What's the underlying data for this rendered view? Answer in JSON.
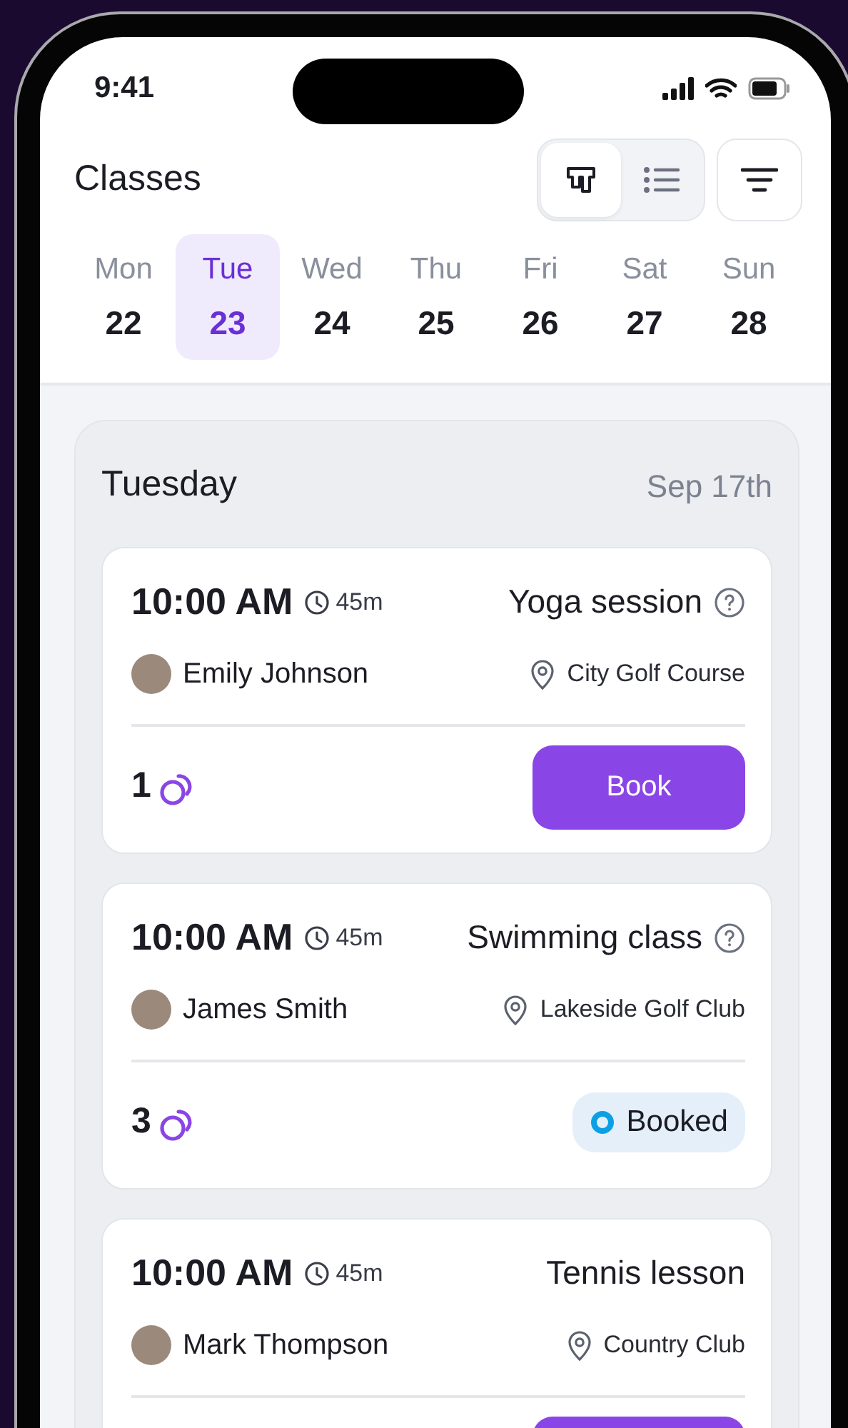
{
  "status_bar": {
    "time": "9:41"
  },
  "header": {
    "title": "Classes",
    "view_toggle": [
      {
        "kind": "board",
        "selected": true
      },
      {
        "kind": "list",
        "selected": false
      }
    ]
  },
  "days": [
    {
      "weekday": "Mon",
      "date": "22",
      "selected": false
    },
    {
      "weekday": "Tue",
      "date": "23",
      "selected": true
    },
    {
      "weekday": "Wed",
      "date": "24",
      "selected": false
    },
    {
      "weekday": "Thu",
      "date": "25",
      "selected": false
    },
    {
      "weekday": "Fri",
      "date": "26",
      "selected": false
    },
    {
      "weekday": "Sat",
      "date": "27",
      "selected": false
    },
    {
      "weekday": "Sun",
      "date": "28",
      "selected": false
    }
  ],
  "day_panel": {
    "title": "Tuesday",
    "date": "Sep 17th",
    "classes": [
      {
        "time": "10:00 AM",
        "duration": "45m",
        "title": "Yoga session",
        "info": true,
        "instructor": "Emily Johnson",
        "location": "City Golf Course",
        "count": "1",
        "action": {
          "kind": "book",
          "label": "Book"
        }
      },
      {
        "time": "10:00 AM",
        "duration": "45m",
        "title": "Swimming class",
        "info": true,
        "instructor": "James Smith",
        "location": "Lakeside Golf Club",
        "count": "3",
        "action": {
          "kind": "booked",
          "label": "Booked"
        }
      },
      {
        "time": "10:00 AM",
        "duration": "45m",
        "title": "Tennis lesson",
        "info": false,
        "instructor": "Mark Thompson",
        "location": "Country Club",
        "action": {
          "kind": "book"
        }
      }
    ]
  }
}
